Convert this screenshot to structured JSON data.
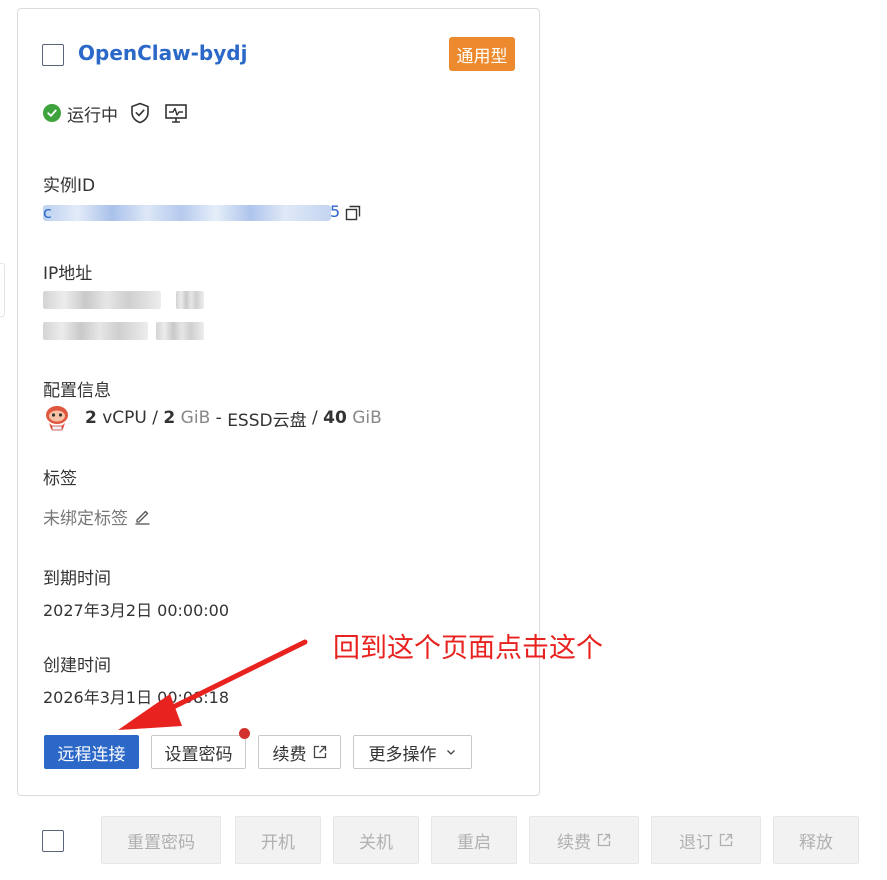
{
  "instance": {
    "name": "OpenClaw-bydj",
    "type_badge": "通用型",
    "status": "运行中",
    "instance_id_label": "实例ID",
    "instance_id_prefix": "c",
    "instance_id_suffix": "5",
    "ip_label": "IP地址",
    "config_label": "配置信息",
    "config": {
      "cpu_value": "2",
      "cpu_unit": "vCPU",
      "mem_value": "2",
      "mem_unit": "GiB",
      "disk_type": "ESSD云盘",
      "disk_value": "40",
      "disk_unit": "GiB",
      "sep_slash": "/",
      "sep_dash": "-"
    },
    "tag_label": "标签",
    "tag_value": "未绑定标签",
    "expire_label": "到期时间",
    "expire_value": "2027年3月2日 00:00:00",
    "created_label": "创建时间",
    "created_value": "2026年3月1日 00:08:18"
  },
  "card_actions": {
    "remote_connect": "远程连接",
    "set_password": "设置密码",
    "renew": "续费",
    "more": "更多操作"
  },
  "annotation": {
    "text": "回到这个页面点击这个",
    "color": "#e8231f"
  },
  "bulk_actions": {
    "reset_password": "重置密码",
    "start": "开机",
    "stop": "关机",
    "restart": "重启",
    "renew": "续费",
    "unsubscribe": "退订",
    "release": "释放"
  },
  "colors": {
    "primary": "#2c68c8",
    "badge": "#ed8a2e",
    "running": "#3ea33d",
    "notice_dot": "#d2322d"
  },
  "icons": [
    "check-circle-icon",
    "shield-check-icon",
    "monitor-icon",
    "copy-icon",
    "os-icon",
    "edit-icon",
    "external-link-icon",
    "chevron-down-icon",
    "arrow-icon"
  ]
}
